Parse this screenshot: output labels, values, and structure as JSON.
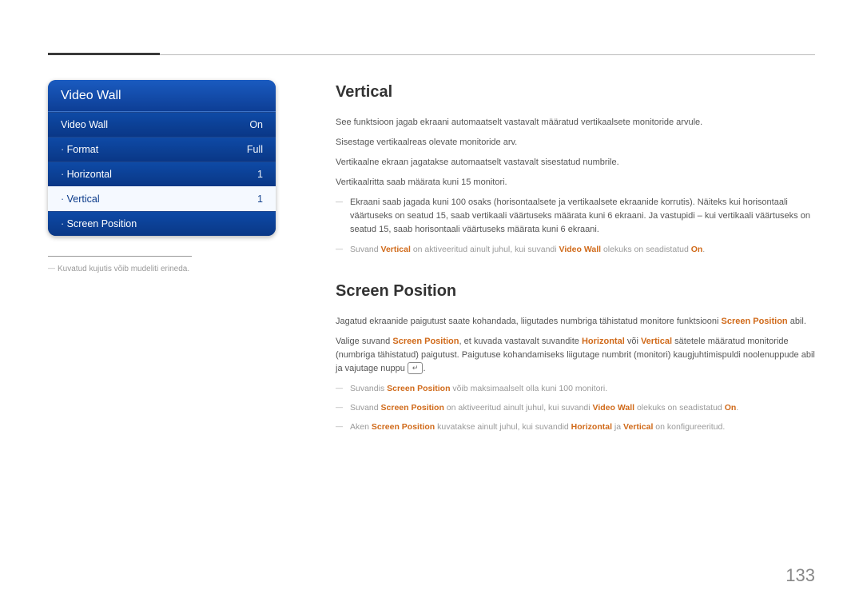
{
  "page_number": "133",
  "sidebar": {
    "title": "Video Wall",
    "rows": [
      {
        "label": "Video Wall",
        "value": "On"
      },
      {
        "label": "Format",
        "value": "Full"
      },
      {
        "label": "Horizontal",
        "value": "1"
      },
      {
        "label": "Vertical",
        "value": "1"
      },
      {
        "label": "Screen Position",
        "value": ""
      }
    ],
    "note": "Kuvatud kujutis võib mudeliti erineda."
  },
  "section_vertical": {
    "heading": "Vertical",
    "p1": "See funktsioon jagab ekraani automaatselt vastavalt määratud vertikaalsete monitoride arvule.",
    "p2": "Sisestage vertikaalreas olevate monitoride arv.",
    "p3": "Vertikaalne ekraan jagatakse automaatselt vastavalt sisestatud numbrile.",
    "p4": "Vertikaalritta saab määrata kuni 15 monitori.",
    "note1": "Ekraani saab jagada kuni 100 osaks (horisontaalsete ja vertikaalsete ekraanide korrutis). Näiteks kui horisontaali väärtuseks on seatud 15, saab vertikaali väärtuseks määrata kuni 6 ekraani. Ja vastupidi – kui vertikaali väärtuseks on seatud 15, saab horisontaali väärtuseks määrata kuni 6 ekraani.",
    "note2_pre": "Suvand ",
    "note2_hl1": "Vertical",
    "note2_mid": " on aktiveeritud ainult juhul, kui suvandi ",
    "note2_hl2": "Video Wall",
    "note2_mid2": " olekuks on seadistatud ",
    "note2_hl3": "On",
    "note2_post": "."
  },
  "section_screenpos": {
    "heading": "Screen Position",
    "p1_pre": "Jagatud ekraanide paigutust saate kohandada, liigutades numbriga tähistatud monitore funktsiooni ",
    "p1_hl": "Screen Position",
    "p1_post": " abil.",
    "p2_pre": "Valige suvand ",
    "p2_hl1": "Screen Position",
    "p2_mid1": ", et kuvada vastavalt suvandite ",
    "p2_hl2": "Horizontal",
    "p2_mid2": " või ",
    "p2_hl3": "Vertical",
    "p2_mid3": " sätetele määratud monitoride (numbriga tähistatud) paigutust. Paigutuse kohandamiseks liigutage numbrit (monitori) kaugjuhtimispuldi noolenuppude abil ja vajutage nuppu ",
    "p2_key": "↵",
    "p2_post": ".",
    "note1_pre": "Suvandis ",
    "note1_hl": "Screen Position",
    "note1_post": " võib maksimaalselt olla kuni 100 monitori.",
    "note2_pre": "Suvand ",
    "note2_hl1": "Screen Position",
    "note2_mid1": " on aktiveeritud ainult juhul, kui suvandi ",
    "note2_hl2": "Video Wall",
    "note2_mid2": " olekuks on seadistatud ",
    "note2_hl3": "On",
    "note2_post": ".",
    "note3_pre": "Aken ",
    "note3_hl1": "Screen Position",
    "note3_mid1": " kuvatakse ainult juhul, kui suvandid ",
    "note3_hl2": "Horizontal",
    "note3_mid2": " ja ",
    "note3_hl3": "Vertical",
    "note3_post": " on konfigureeritud."
  }
}
